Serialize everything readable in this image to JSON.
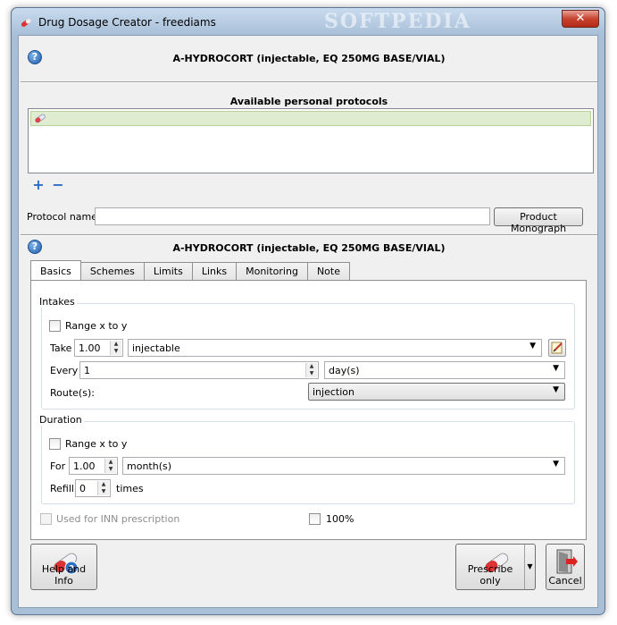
{
  "window": {
    "title": "Drug Dosage Creator - freediams",
    "close_label": "✕"
  },
  "header": {
    "drug_name": "A-HYDROCORT (injectable, EQ 250MG BASE/VIAL)"
  },
  "protocols": {
    "title": "Available personal protocols",
    "add_label": "+",
    "remove_label": "−"
  },
  "protocol_name": {
    "label": "Protocol name",
    "value": ""
  },
  "monograph_button": "Product Monograph",
  "dosage_header": {
    "drug_name": "A-HYDROCORT (injectable, EQ 250MG BASE/VIAL)"
  },
  "tabs": [
    "Basics",
    "Schemes",
    "Limits",
    "Links",
    "Monitoring",
    "Note"
  ],
  "intakes": {
    "title": "Intakes",
    "range_label": "Range x to y",
    "take_label": "Take",
    "take_value": "1.00",
    "form_value": "injectable",
    "every_label": "Every",
    "every_value": "1",
    "period_value": "day(s)",
    "route_label": "Route(s):",
    "route_value": "injection"
  },
  "duration": {
    "title": "Duration",
    "range_label": "Range x to y",
    "for_label": "For",
    "for_value": "1.00",
    "unit_value": "month(s)",
    "refill_label": "Refill",
    "refill_value": "0",
    "times_label": "times"
  },
  "options": {
    "inn_label": "Used for INN prescription",
    "percent_label": "100%"
  },
  "footer": {
    "help_label": "Help and Info",
    "prescribe_label": "Prescribe only",
    "cancel_label": "Cancel"
  },
  "watermark": "SOFTPEDIA",
  "colors": {
    "title_bar": "#a9bfd6",
    "close_button": "#c7432f",
    "list_selection": "#dfeccf"
  }
}
